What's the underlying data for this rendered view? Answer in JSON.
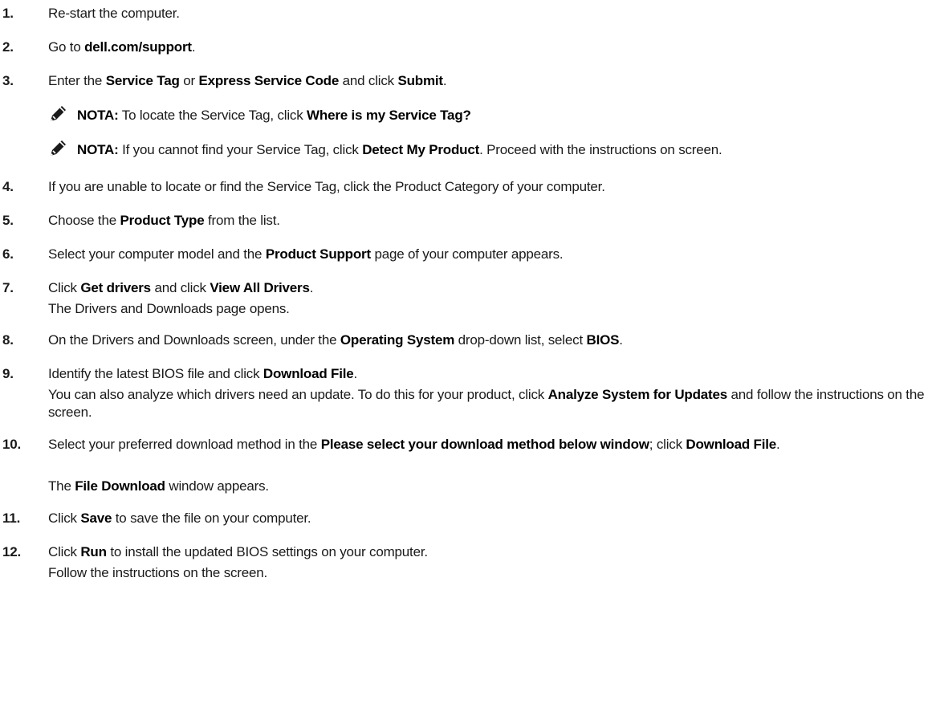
{
  "steps": [
    {
      "num": "1.",
      "parts": [
        "Re-start the computer."
      ]
    },
    {
      "num": "2.",
      "parts": [
        "Go to ",
        "dell.com/support",
        "."
      ]
    },
    {
      "num": "3.",
      "parts": [
        "Enter the ",
        "Service Tag",
        " or ",
        "Express Service Code",
        " and click ",
        "Submit",
        "."
      ]
    },
    {
      "num": "4.",
      "parts": [
        "If you are unable to locate or find the Service Tag, click the Product Category of your computer."
      ]
    },
    {
      "num": "5.",
      "parts": [
        "Choose the ",
        "Product Type",
        " from the list."
      ]
    },
    {
      "num": "6.",
      "parts": [
        "Select your computer model and the ",
        "Product Support",
        " page of your computer appears."
      ]
    },
    {
      "num": "7.",
      "parts": [
        "Click ",
        "Get drivers",
        " and click ",
        "View All Drivers",
        "."
      ],
      "sub": [
        "The Drivers and Downloads page opens."
      ]
    },
    {
      "num": "8.",
      "parts": [
        "On the Drivers and Downloads screen, under the ",
        "Operating System",
        " drop-down list, select ",
        "BIOS",
        "."
      ]
    },
    {
      "num": "9.",
      "parts": [
        "Identify the latest BIOS file and click ",
        "Download File",
        "."
      ],
      "sub": [
        "You can also analyze which drivers need an update. To do this for your product, click ",
        "Analyze System for Updates",
        " and follow the instructions on the screen."
      ]
    },
    {
      "num": "10.",
      "parts": [
        "Select your preferred download method in the ",
        "Please select your download method below window",
        "; click ",
        "Download File",
        "."
      ],
      "sub": [
        "The ",
        "File Download",
        " window appears."
      ]
    },
    {
      "num": "11.",
      "parts": [
        "Click ",
        "Save",
        " to save the file on your computer."
      ]
    },
    {
      "num": "12.",
      "parts": [
        "Click ",
        "Run",
        " to install the updated BIOS settings on your computer."
      ],
      "sub": [
        "Follow the instructions on the screen."
      ]
    }
  ],
  "notes": [
    {
      "label": "NOTA:",
      "parts": [
        " To locate the Service Tag, click ",
        "Where is my Service Tag?"
      ]
    },
    {
      "label": "NOTA:",
      "parts": [
        " If you cannot find your Service Tag, click ",
        "Detect My Product",
        ". Proceed with the instructions on screen."
      ]
    }
  ]
}
